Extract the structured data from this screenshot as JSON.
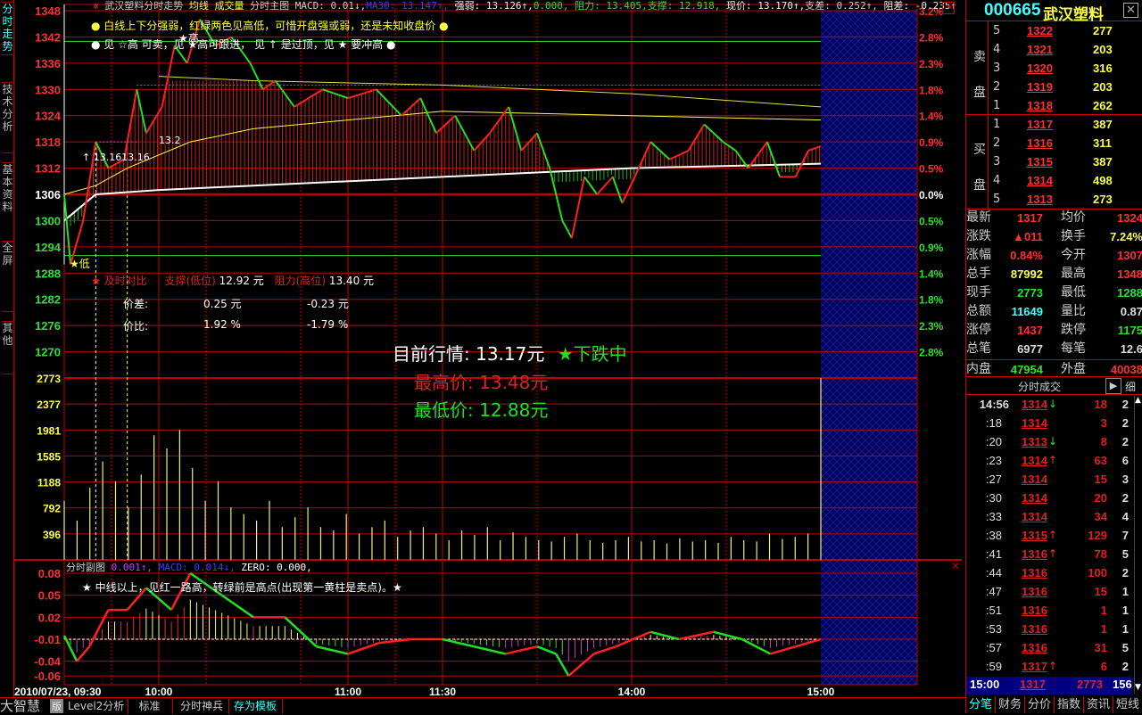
{
  "left_tabs": [
    "分时走势",
    "技术分析",
    "基本资料",
    "全屏",
    "其他"
  ],
  "header": {
    "title": "武汉塑料分时走势",
    "avg_line": "均线",
    "volume": "成交量",
    "main_chart": "分时主图",
    "macd": "MACD: 0.01↓,",
    "ma30": "MA30: 13.147↑,",
    "strength": "强弱: 13.126↑,",
    "zero": "0.000,",
    "resist": "阻力: 13.405,",
    "support": "支撑: 12.918,",
    "price": "现价: 13.170↑,",
    "support_diff": "支差: 0.252↑,",
    "resist_diff": "阻差: -0.235↑"
  },
  "notes": {
    "line1": "白线上下分强弱，红绿两色见高低，可惜开盘强或弱，还是未知收盘价",
    "line2": "见 ☆高 可卖，见 ★高可跟进，  见 ↑ 是过顶，见 ★ 要冲高"
  },
  "markers": {
    "high": "★高",
    "low": "★低",
    "label_1316": "13.1613.16",
    "label_132": "13.2"
  },
  "compare": {
    "title": "及时对比",
    "support_label": "支撑(低位)",
    "support_val": "12.92 元",
    "resist_label": "阻力(高位)",
    "resist_val": "13.40 元",
    "diff_label": "价差:",
    "diff_s": "0.25 元",
    "diff_r": "-0.23 元",
    "ratio_label": "价比:",
    "ratio_s": "1.92 %",
    "ratio_r": "-1.79 %"
  },
  "overlay": {
    "current_label": "目前行情: 13.17元",
    "trend": "★下跌中",
    "high": "最高价: 13.48元",
    "low": "最低价: 12.88元"
  },
  "sub_header": {
    "title": "分时副图",
    "v1": "0.001↑,",
    "macd": "MACD: 0.014↓,",
    "zero": "ZERO: 0.000,"
  },
  "sub_note": "★ 中线以上，见红一路高，转绿前是高点(出现第一黄柱是卖点)。★",
  "colors": {
    "up": "#ff2020",
    "down": "#20e020",
    "grid": "#c00000",
    "yellow": "#ffff40",
    "cyan": "#40ffff",
    "blue_bg": "#000080"
  },
  "chart_data": {
    "type": "line",
    "title": "武汉塑料分时走势",
    "prev_close": 1306,
    "price_ticks": [
      1348,
      1342,
      1336,
      1330,
      1324,
      1318,
      1312,
      1306,
      1300,
      1294,
      1288,
      1282,
      1276,
      1270
    ],
    "pct_ticks": [
      "3.2%",
      "2.8%",
      "2.3%",
      "1.8%",
      "1.4%",
      "0.9%",
      "0.5%",
      "0.0%",
      "0.5%",
      "0.9%",
      "1.4%",
      "1.8%",
      "2.3%",
      "2.8%"
    ],
    "volume_ticks": [
      2773,
      2377,
      1981,
      1585,
      1188,
      792,
      396
    ],
    "macd_ticks": [
      "0.08",
      "0.05",
      "0.02",
      "-0.01",
      "-0.04",
      "-0.06"
    ],
    "time_ticks": [
      {
        "m": 0,
        "label": "2010/07/23, 09:30"
      },
      {
        "m": 30,
        "label": "10:00"
      },
      {
        "m": 90,
        "label": "11:00"
      },
      {
        "m": 120,
        "label": "11:30"
      },
      {
        "m": 180,
        "label": "14:00"
      },
      {
        "m": 240,
        "label": "15:00"
      }
    ],
    "price": [
      [
        0,
        1306
      ],
      [
        2,
        1290
      ],
      [
        6,
        1300
      ],
      [
        10,
        1318
      ],
      [
        14,
        1312
      ],
      [
        19,
        1314
      ],
      [
        23,
        1330
      ],
      [
        26,
        1320
      ],
      [
        31,
        1326
      ],
      [
        35,
        1340
      ],
      [
        39,
        1336
      ],
      [
        43,
        1346
      ],
      [
        48,
        1340
      ],
      [
        53,
        1342
      ],
      [
        59,
        1336
      ],
      [
        63,
        1330
      ],
      [
        67,
        1332
      ],
      [
        73,
        1326
      ],
      [
        82,
        1330
      ],
      [
        90,
        1328
      ],
      [
        99,
        1330
      ],
      [
        107,
        1324
      ],
      [
        113,
        1328
      ],
      [
        118,
        1320
      ],
      [
        124,
        1324
      ],
      [
        130,
        1316
      ],
      [
        135,
        1320
      ],
      [
        141,
        1326
      ],
      [
        145,
        1316
      ],
      [
        150,
        1320
      ],
      [
        154,
        1312
      ],
      [
        158,
        1300
      ],
      [
        161,
        1296
      ],
      [
        165,
        1310
      ],
      [
        169,
        1306
      ],
      [
        174,
        1310
      ],
      [
        177,
        1304
      ],
      [
        181,
        1310
      ],
      [
        186,
        1318
      ],
      [
        192,
        1314
      ],
      [
        198,
        1316
      ],
      [
        203,
        1322
      ],
      [
        209,
        1318
      ],
      [
        213,
        1316
      ],
      [
        217,
        1312
      ],
      [
        223,
        1318
      ],
      [
        227,
        1310
      ],
      [
        232,
        1310
      ],
      [
        236,
        1316
      ],
      [
        240,
        1317
      ]
    ],
    "avg": [
      [
        0,
        1306
      ],
      [
        10,
        1308
      ],
      [
        20,
        1312
      ],
      [
        40,
        1318
      ],
      [
        60,
        1321
      ],
      [
        90,
        1323
      ],
      [
        120,
        1325
      ],
      [
        180,
        1324
      ],
      [
        240,
        1323
      ]
    ],
    "strength": [
      [
        0,
        1300
      ],
      [
        10,
        1306
      ],
      [
        30,
        1307
      ],
      [
        60,
        1308
      ],
      [
        120,
        1310
      ],
      [
        180,
        1312
      ],
      [
        240,
        1313
      ]
    ],
    "ma_line": [
      [
        30,
        1333
      ],
      [
        60,
        1332
      ],
      [
        120,
        1331
      ],
      [
        180,
        1329
      ],
      [
        240,
        1326
      ]
    ],
    "volume": [
      900,
      600,
      1100,
      1500,
      1200,
      800,
      1300,
      1900,
      1700,
      1981,
      1400,
      900,
      1200,
      800,
      700,
      600,
      900,
      500,
      650,
      800,
      500,
      450,
      700,
      400,
      500,
      600,
      350,
      450,
      500,
      400,
      300,
      450,
      380,
      500,
      300,
      420,
      350,
      300,
      280,
      350,
      400,
      300,
      260,
      300,
      350,
      280,
      300,
      250,
      330,
      280,
      300,
      260,
      350,
      300,
      280,
      400,
      320,
      350,
      400,
      2773
    ],
    "macd": [
      [
        0,
        -0.005
      ],
      [
        4,
        -0.04
      ],
      [
        8,
        -0.02
      ],
      [
        14,
        0.03
      ],
      [
        20,
        0.03
      ],
      [
        26,
        0.06
      ],
      [
        34,
        0.03
      ],
      [
        40,
        0.08
      ],
      [
        50,
        0.05
      ],
      [
        60,
        0.02
      ],
      [
        70,
        0.02
      ],
      [
        80,
        -0.02
      ],
      [
        90,
        -0.03
      ],
      [
        100,
        -0.015
      ],
      [
        110,
        -0.01
      ],
      [
        120,
        -0.01
      ],
      [
        130,
        -0.02
      ],
      [
        140,
        -0.03
      ],
      [
        150,
        -0.02
      ],
      [
        156,
        -0.03
      ],
      [
        160,
        -0.06
      ],
      [
        168,
        -0.03
      ],
      [
        175,
        -0.02
      ],
      [
        186,
        0.0
      ],
      [
        195,
        -0.01
      ],
      [
        206,
        0.0
      ],
      [
        215,
        -0.01
      ],
      [
        224,
        -0.03
      ],
      [
        232,
        -0.02
      ],
      [
        240,
        -0.01
      ]
    ]
  },
  "quote": {
    "code": "000665",
    "name": "武汉塑料",
    "sell_label": "卖盘",
    "buy_label": "买盘",
    "sell": [
      {
        "n": "5",
        "p": "1322",
        "v": "277"
      },
      {
        "n": "4",
        "p": "1321",
        "v": "203"
      },
      {
        "n": "3",
        "p": "1320",
        "v": "316"
      },
      {
        "n": "2",
        "p": "1319",
        "v": "203"
      },
      {
        "n": "1",
        "p": "1318",
        "v": "262"
      }
    ],
    "buy": [
      {
        "n": "1",
        "p": "1317",
        "v": "387"
      },
      {
        "n": "2",
        "p": "1316",
        "v": "311"
      },
      {
        "n": "3",
        "p": "1315",
        "v": "387"
      },
      {
        "n": "4",
        "p": "1314",
        "v": "498"
      },
      {
        "n": "5",
        "p": "1313",
        "v": "273"
      }
    ],
    "stats": [
      {
        "l1": "最新",
        "v1": "1317",
        "c1": "#ff3030",
        "l2": "均价",
        "v2": "1324",
        "c2": "#ff3030"
      },
      {
        "l1": "涨跌",
        "v1": "▲011",
        "c1": "#ff3030",
        "l2": "换手",
        "v2": "7.24%",
        "c2": "#ffff40"
      },
      {
        "l1": "涨幅",
        "v1": "0.84%",
        "c1": "#ff3030",
        "l2": "今开",
        "v2": "1307",
        "c2": "#ff3030"
      },
      {
        "l1": "总手",
        "v1": "87992",
        "c1": "#ffff40",
        "l2": "最高",
        "v2": "1348",
        "c2": "#ff3030"
      },
      {
        "l1": "现手",
        "v1": "2773",
        "c1": "#30e030",
        "l2": "最低",
        "v2": "1288",
        "c2": "#30e030"
      },
      {
        "l1": "总额",
        "v1": "11649",
        "c1": "#40ffff",
        "l2": "量比",
        "v2": "0.87",
        "c2": "#ddd"
      },
      {
        "l1": "涨停",
        "v1": "1437",
        "c1": "#ff3030",
        "l2": "跌停",
        "v2": "1175",
        "c2": "#30e030"
      },
      {
        "l1": "总笔",
        "v1": "6977",
        "c1": "#ddd",
        "l2": "每笔",
        "v2": "12.6",
        "c2": "#ddd"
      },
      {
        "l1": "内盘",
        "v1": "47954",
        "c1": "#30e030",
        "l2": "外盘",
        "v2": "40038",
        "c2": "#ff3030"
      }
    ],
    "ticks_title": "分时成交",
    "detail": "细",
    "ticks": [
      {
        "t": "14:56",
        "p": "1314",
        "a": "↓",
        "v": "18",
        "n": "2"
      },
      {
        "t": ":18",
        "p": "1314",
        "a": "",
        "v": "3",
        "n": "2"
      },
      {
        "t": ":20",
        "p": "1313",
        "a": "↓",
        "v": "8",
        "n": "2"
      },
      {
        "t": ":23",
        "p": "1314",
        "a": "↑",
        "v": "63",
        "n": "6"
      },
      {
        "t": ":27",
        "p": "1314",
        "a": "",
        "v": "15",
        "n": "3"
      },
      {
        "t": ":30",
        "p": "1314",
        "a": "",
        "v": "20",
        "n": "2"
      },
      {
        "t": ":33",
        "p": "1314",
        "a": "",
        "v": "34",
        "n": "4"
      },
      {
        "t": ":38",
        "p": "1315",
        "a": "↑",
        "v": "129",
        "n": "7"
      },
      {
        "t": ":41",
        "p": "1316",
        "a": "↑",
        "v": "78",
        "n": "5"
      },
      {
        "t": ":44",
        "p": "1316",
        "a": "",
        "v": "100",
        "n": "2"
      },
      {
        "t": ":47",
        "p": "1316",
        "a": "",
        "v": "15",
        "n": "1"
      },
      {
        "t": ":51",
        "p": "1316",
        "a": "",
        "v": "1",
        "n": "1"
      },
      {
        "t": ":53",
        "p": "1316",
        "a": "",
        "v": "1",
        "n": "1"
      },
      {
        "t": ":57",
        "p": "1316",
        "a": "",
        "v": "31",
        "n": "5"
      },
      {
        "t": ":59",
        "p": "1317",
        "a": "↑",
        "v": "6",
        "n": "2"
      }
    ],
    "last": {
      "t": "15:00",
      "p": "1317",
      "v": "2773",
      "n": "156"
    },
    "tabs": [
      "分笔",
      "财务",
      "分价",
      "指数",
      "资讯",
      "短线"
    ]
  },
  "bottom_tabs": {
    "brand": "大智慧",
    "mode": "版",
    "l2": "Level2分析",
    "std": "标准",
    "shenbing": "分时神兵",
    "save": "存为模板"
  }
}
